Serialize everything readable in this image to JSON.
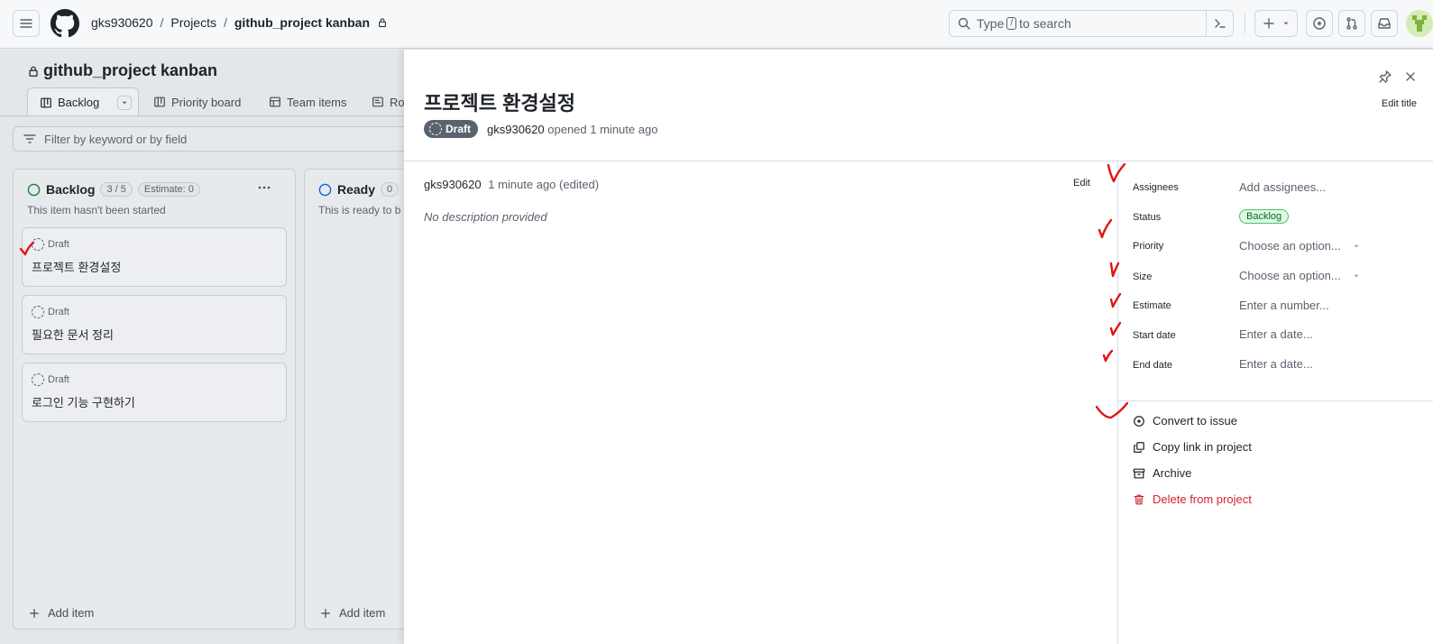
{
  "header": {
    "breadcrumb": [
      "gks930620",
      "Projects",
      "github_project kanban"
    ],
    "search": {
      "prefix": "Type",
      "key": "/",
      "suffix": "to search"
    },
    "icons": [
      "menu-icon",
      "github-logo-icon",
      "search-icon",
      "command-palette-icon",
      "plus-icon",
      "issues-icon",
      "pull-requests-icon",
      "inbox-icon"
    ]
  },
  "project": {
    "title": "github_project kanban",
    "tabs": [
      {
        "label": "Backlog",
        "icon": "board-icon"
      },
      {
        "label": "Priority board",
        "icon": "board-icon"
      },
      {
        "label": "Team items",
        "icon": "table-icon"
      },
      {
        "label": "Ro",
        "icon": "roadmap-icon"
      }
    ],
    "filter_placeholder": "Filter by keyword or by field"
  },
  "columns": [
    {
      "name": "Backlog",
      "count": "3 / 5",
      "estimate": "Estimate: 0",
      "description": "This item hasn't been started",
      "status_color": "#1a7f37",
      "cards": [
        {
          "status": "Draft",
          "title": "프로젝트 환경설정"
        },
        {
          "status": "Draft",
          "title": "필요한 문서 정리"
        },
        {
          "status": "Draft",
          "title": "로그인 기능 구현하기"
        }
      ],
      "add_label": "Add item"
    },
    {
      "name": "Ready",
      "count": "0",
      "description": "This is ready to b",
      "status_color": "#0969da",
      "add_label": "Add item"
    }
  ],
  "panel": {
    "title": "프로젝트 환경설정",
    "badge": "Draft",
    "author": "gks930620",
    "opened_text": "opened 1 minute ago",
    "edit_title": "Edit title",
    "comment": {
      "author": "gks930620",
      "meta": "1 minute ago (edited)",
      "edit": "Edit",
      "body": "No description provided"
    },
    "fields": [
      {
        "label": "Assignees",
        "value": "Add assignees..."
      },
      {
        "label": "Status",
        "value": "Backlog"
      },
      {
        "label": "Priority",
        "value": "Choose an option..."
      },
      {
        "label": "Size",
        "value": "Choose an option..."
      },
      {
        "label": "Estimate",
        "value": "Enter a number..."
      },
      {
        "label": "Start date",
        "value": "Enter a date..."
      },
      {
        "label": "End date",
        "value": "Enter a date..."
      }
    ],
    "actions": [
      {
        "label": "Convert to issue",
        "icon": "issue-open-icon"
      },
      {
        "label": "Copy link in project",
        "icon": "copy-icon"
      },
      {
        "label": "Archive",
        "icon": "archive-icon"
      },
      {
        "label": "Delete from project",
        "icon": "trash-icon",
        "color": "#d1242f"
      }
    ]
  },
  "colors": {
    "accent_green": "#1a7f37",
    "danger": "#d1242f",
    "annotation": "#e01414"
  }
}
